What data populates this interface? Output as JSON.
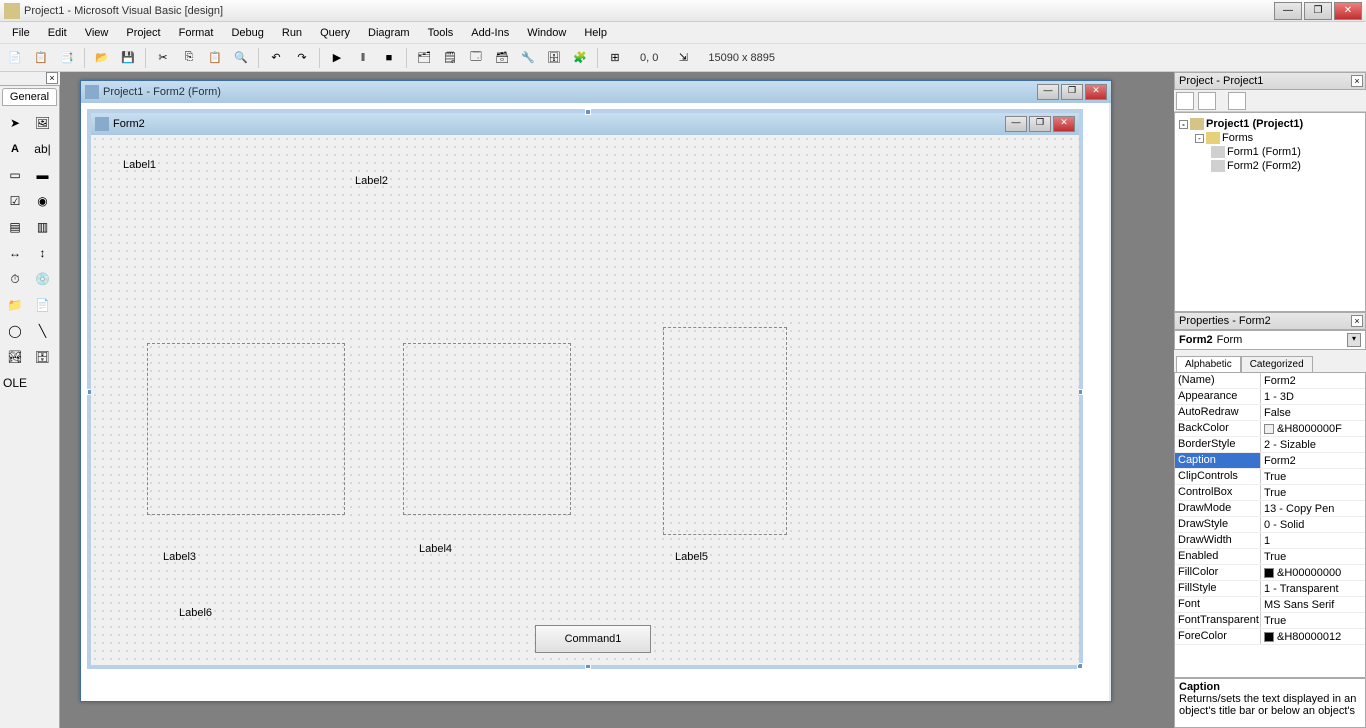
{
  "app": {
    "title": "Project1 - Microsoft Visual Basic [design]"
  },
  "menu": [
    "File",
    "Edit",
    "View",
    "Project",
    "Format",
    "Debug",
    "Run",
    "Query",
    "Diagram",
    "Tools",
    "Add-Ins",
    "Window",
    "Help"
  ],
  "coords": {
    "pos": "0, 0",
    "size": "15090 x 8895"
  },
  "toolbox": {
    "tab": "General"
  },
  "child": {
    "title": "Project1 - Form2 (Form)"
  },
  "form": {
    "caption": "Form2",
    "labels": {
      "l1": "Label1",
      "l2": "Label2",
      "l3": "Label3",
      "l4": "Label4",
      "l5": "Label5",
      "l6": "Label6"
    },
    "command": "Command1"
  },
  "project": {
    "title": "Project - Project1",
    "root": "Project1 (Project1)",
    "folder": "Forms",
    "form1": "Form1 (Form1)",
    "form2": "Form2 (Form2)"
  },
  "props": {
    "title": "Properties - Form2",
    "selector": {
      "name": "Form2",
      "type": "Form"
    },
    "tabs": {
      "alpha": "Alphabetic",
      "cat": "Categorized"
    },
    "rows": [
      {
        "n": "(Name)",
        "v": "Form2"
      },
      {
        "n": "Appearance",
        "v": "1 - 3D"
      },
      {
        "n": "AutoRedraw",
        "v": "False"
      },
      {
        "n": "BackColor",
        "v": "&H8000000F",
        "color": "#f0f0f0"
      },
      {
        "n": "BorderStyle",
        "v": "2 - Sizable"
      },
      {
        "n": "Caption",
        "v": "Form2",
        "sel": true
      },
      {
        "n": "ClipControls",
        "v": "True"
      },
      {
        "n": "ControlBox",
        "v": "True"
      },
      {
        "n": "DrawMode",
        "v": "13 - Copy Pen"
      },
      {
        "n": "DrawStyle",
        "v": "0 - Solid"
      },
      {
        "n": "DrawWidth",
        "v": "1"
      },
      {
        "n": "Enabled",
        "v": "True"
      },
      {
        "n": "FillColor",
        "v": "&H00000000",
        "color": "#000000"
      },
      {
        "n": "FillStyle",
        "v": "1 - Transparent"
      },
      {
        "n": "Font",
        "v": "MS Sans Serif"
      },
      {
        "n": "FontTransparent",
        "v": "True"
      },
      {
        "n": "ForeColor",
        "v": "&H80000012",
        "color": "#000000"
      }
    ],
    "desc": {
      "name": "Caption",
      "text": "Returns/sets the text displayed in an object's title bar or below an object's"
    }
  }
}
